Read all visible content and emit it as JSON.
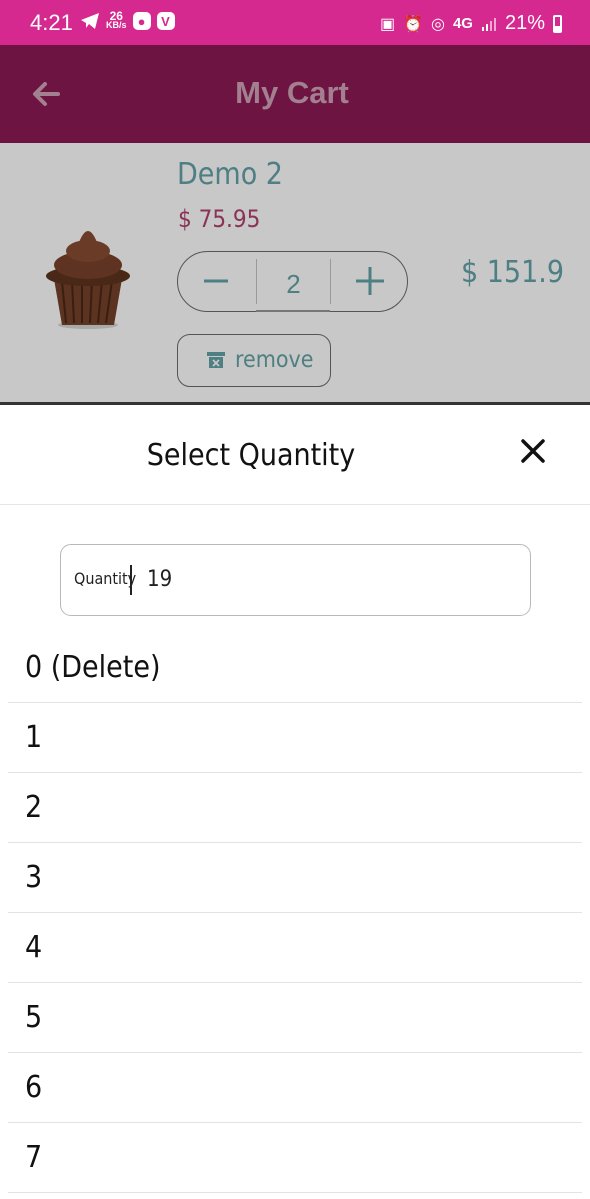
{
  "status_bar": {
    "time": "4:21",
    "net_speed_value": "26",
    "net_speed_unit": "KB/s",
    "app_badge_v": "V",
    "network": "4G",
    "battery": "21%"
  },
  "app_bar": {
    "title": "My Cart",
    "back_icon": "back-arrow-icon"
  },
  "cart_item": {
    "name": "Demo 2",
    "unit_price": "$ 75.95",
    "quantity": "2",
    "line_total": "$ 151.9",
    "remove_label": "remove",
    "image_icon": "cupcake-image"
  },
  "quantity_sheet": {
    "title": "Select Quantity",
    "close_icon": "close-icon",
    "field_label": "Quantity",
    "field_value": "19",
    "options": [
      "0 (Delete)",
      "1",
      "2",
      "3",
      "4",
      "5",
      "6",
      "7"
    ]
  },
  "colors": {
    "status_bar": "#d6298f",
    "app_bar": "#6d1443",
    "teal_text": "#4d7f83",
    "price_text": "#8a3356"
  }
}
